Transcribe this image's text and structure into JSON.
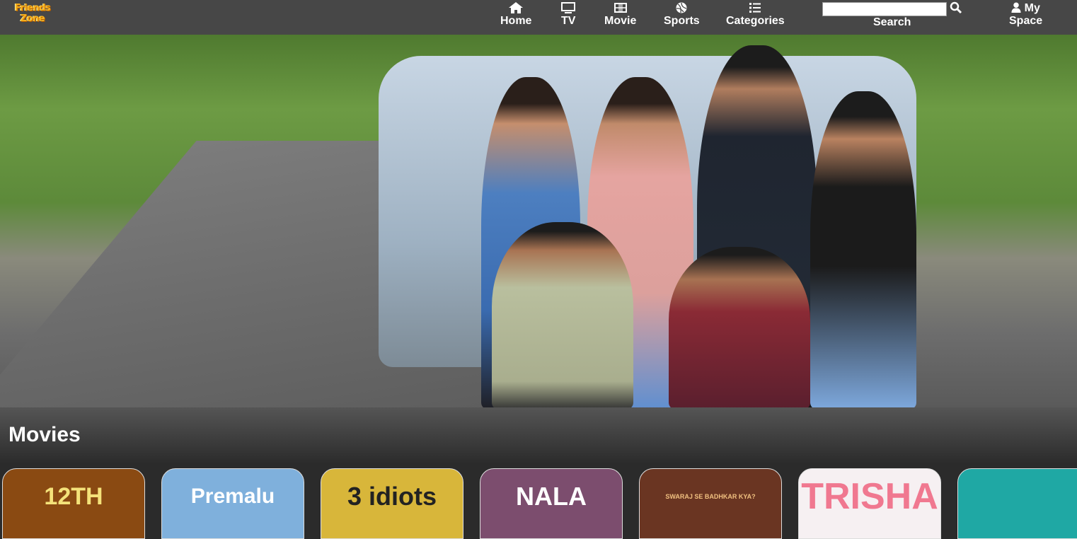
{
  "brand": {
    "logo_line1": "Friends",
    "logo_line2": "Zone"
  },
  "nav": {
    "items": [
      {
        "label": "Home",
        "icon": "home-icon"
      },
      {
        "label": "TV",
        "icon": "tv-icon"
      },
      {
        "label": "Movie",
        "icon": "film-icon"
      },
      {
        "label": "Sports",
        "icon": "ball-icon"
      },
      {
        "label": "Categories",
        "icon": "list-icon"
      }
    ],
    "search": {
      "label": "Search",
      "value": "",
      "placeholder": ""
    },
    "myspace": {
      "line1": "My",
      "line2": "Space",
      "icon": "user-icon"
    }
  },
  "section": {
    "title": "Movies"
  },
  "movies": [
    {
      "title": "12TH",
      "bg": "#8a4a12"
    },
    {
      "title": "Premalu",
      "bg": "#7fb0dc"
    },
    {
      "title": "3 idiots",
      "bg": "#d8b63a"
    },
    {
      "title": "NALA",
      "bg": "#7c4d6e"
    },
    {
      "title": "SWARAJ SE BADHKAR KYA?",
      "bg": "#6a3522"
    },
    {
      "title": "TRISHA",
      "bg": "#f6f0f2"
    },
    {
      "title": "",
      "bg": "#1fa8a4"
    }
  ]
}
